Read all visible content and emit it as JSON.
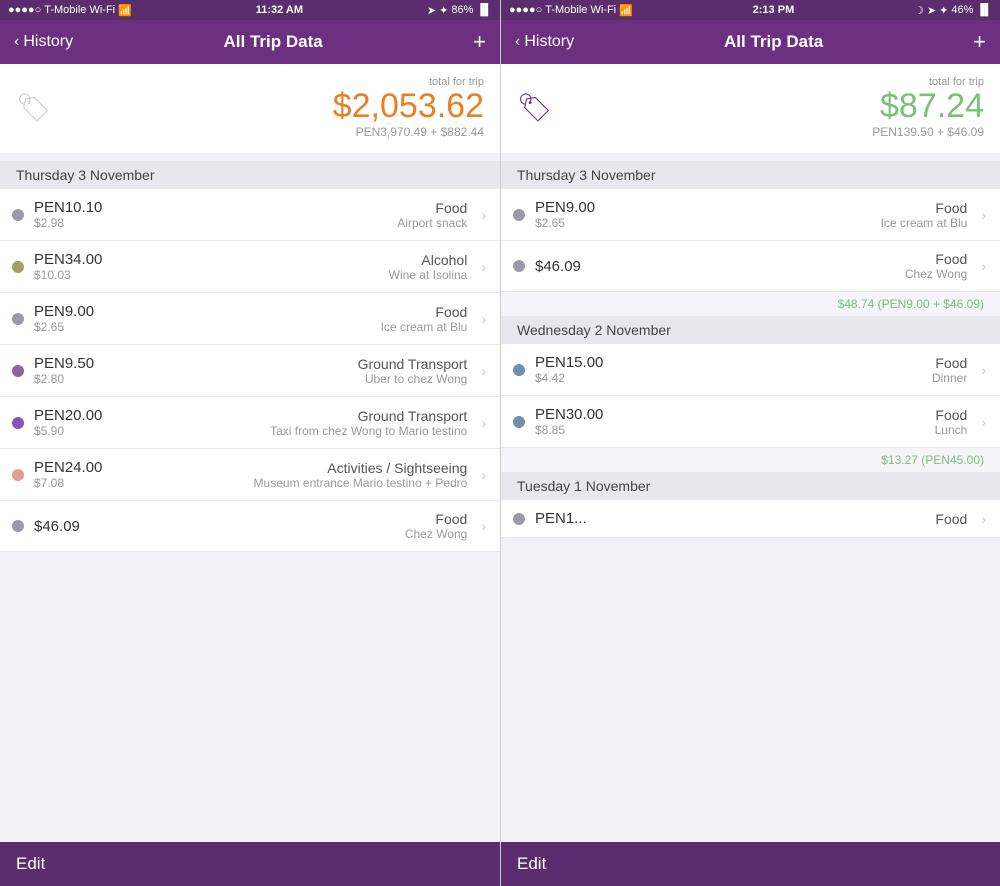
{
  "panels": [
    {
      "id": "panel-left",
      "status": {
        "carrier": "T-Mobile Wi-Fi",
        "time": "11:32 AM",
        "battery": "86%"
      },
      "header": {
        "back_label": "History",
        "title": "All Trip Data",
        "add_label": "+"
      },
      "total": {
        "label": "total for trip",
        "amount": "$2,053.62",
        "sub": "PEN3,970.49 + $882.44",
        "icon_style": "outline"
      },
      "sections": [
        {
          "id": "thursday-left",
          "date": "Thursday 3 November",
          "items": [
            {
              "dot": "dot-gray",
              "pen": "PEN10.10",
              "usd": "$2.98",
              "category": "Food",
              "desc": "Airport snack"
            },
            {
              "dot": "dot-olive",
              "pen": "PEN34.00",
              "usd": "$10.03",
              "category": "Alcohol",
              "desc": "Wine at Isolina"
            },
            {
              "dot": "dot-gray",
              "pen": "PEN9.00",
              "usd": "$2.65",
              "category": "Food",
              "desc": "Ice cream at Blu"
            },
            {
              "dot": "dot-purple",
              "pen": "PEN9.50",
              "usd": "$2.80",
              "category": "Ground Transport",
              "desc": "Uber to chez Wong"
            },
            {
              "dot": "dot-violet",
              "pen": "PEN20.00",
              "usd": "$5.90",
              "category": "Ground Transport",
              "desc": "Taxi from chez Wong to Mario testino"
            },
            {
              "dot": "dot-pink",
              "pen": "PEN24.00",
              "usd": "$7.08",
              "category": "Activities / Sightseeing",
              "desc": "Museum entrance Mario testino + Pedro"
            },
            {
              "dot": "dot-gray",
              "pen": "$46.09",
              "usd": "",
              "category": "Food",
              "desc": "Chez Wong"
            }
          ]
        }
      ]
    },
    {
      "id": "panel-right",
      "status": {
        "carrier": "T-Mobile Wi-Fi",
        "time": "2:13 PM",
        "battery": "46%"
      },
      "header": {
        "back_label": "History",
        "title": "All Trip Data",
        "add_label": "+"
      },
      "total": {
        "label": "total for trip",
        "amount": "$87.24",
        "sub": "PEN139.50 + $46.09",
        "icon_style": "filled"
      },
      "sections": [
        {
          "id": "thursday-right",
          "date": "Thursday 3 November",
          "items": [
            {
              "dot": "dot-gray",
              "pen": "PEN9.00",
              "usd": "$2.65",
              "category": "Food",
              "desc": "Ice cream at Blu"
            },
            {
              "dot": "dot-gray",
              "pen": "$46.09",
              "usd": "",
              "category": "Food",
              "desc": "Chez Wong"
            }
          ],
          "subtotal": "$48.74 (PEN9.00 + $46.09)"
        },
        {
          "id": "wednesday-right",
          "date": "Wednesday 2 November",
          "items": [
            {
              "dot": "dot-blue",
              "pen": "PEN15.00",
              "usd": "$4.42",
              "category": "Food",
              "desc": "Dinner"
            },
            {
              "dot": "dot-blue",
              "pen": "PEN30.00",
              "usd": "$8.85",
              "category": "Food",
              "desc": "Lunch"
            }
          ],
          "subtotal": "$13.27 (PEN45.00)"
        },
        {
          "id": "tuesday-right",
          "date": "Tuesday 1 November",
          "items": [
            {
              "dot": "dot-gray",
              "pen": "PEN1...",
              "usd": "",
              "category": "Food",
              "desc": ""
            }
          ]
        }
      ]
    }
  ],
  "bottom": {
    "edit_label": "Edit"
  }
}
